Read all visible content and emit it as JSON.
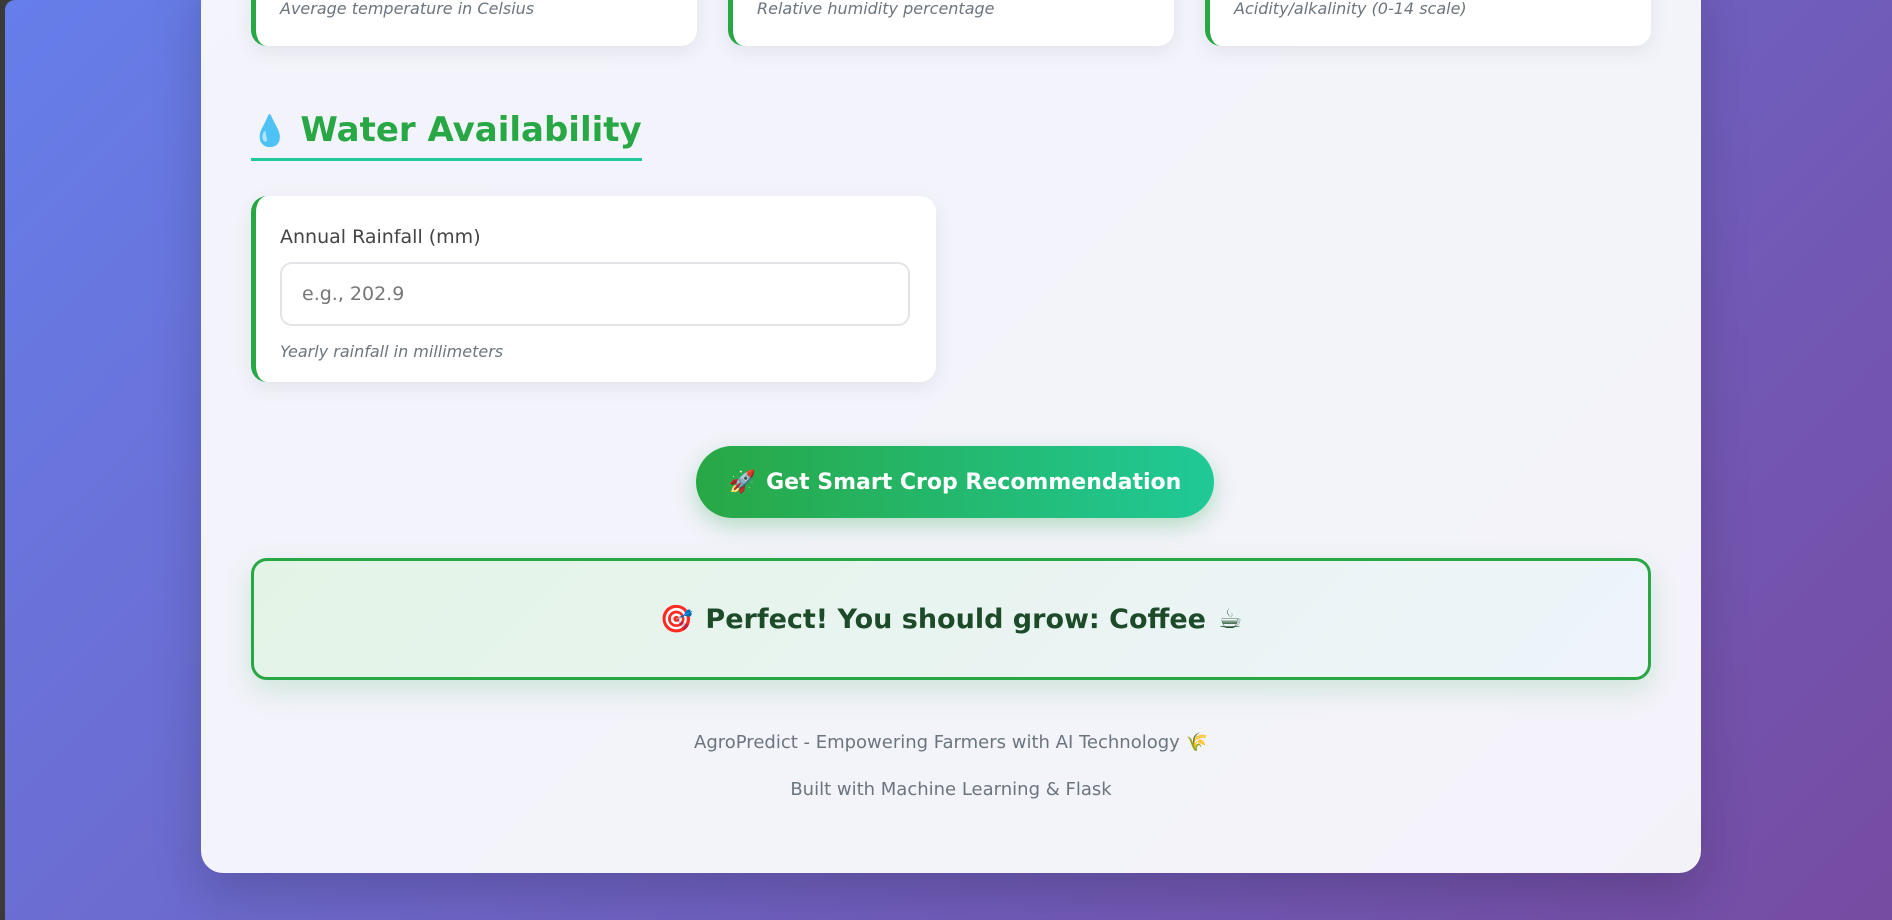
{
  "top_fields": [
    {
      "help": "Average temperature in Celsius"
    },
    {
      "help": "Relative humidity percentage"
    },
    {
      "help": "Acidity/alkalinity (0-14 scale)"
    }
  ],
  "water_section": {
    "icon": "💧",
    "icon_name": "water-drop-icon",
    "title": "Water Availability"
  },
  "rainfall_field": {
    "label": "Annual Rainfall (mm)",
    "placeholder": "e.g., 202.9",
    "value": "",
    "help": "Yearly rainfall in millimeters"
  },
  "submit_button": {
    "icon": "🚀",
    "label": "Get Smart Crop Recommendation"
  },
  "result": {
    "icon": "🎯",
    "text": "Perfect! You should grow: Coffee",
    "crop_icon": "☕"
  },
  "footer": {
    "line1": "AgroPredict - Empowering Farmers with AI Technology",
    "line1_icon": "🌾",
    "line2": "Built with Machine Learning & Flask"
  },
  "colors": {
    "accent_green": "#28a745",
    "accent_teal": "#20c997",
    "bg_gradient_start": "#667eea",
    "bg_gradient_end": "#764ba2"
  }
}
